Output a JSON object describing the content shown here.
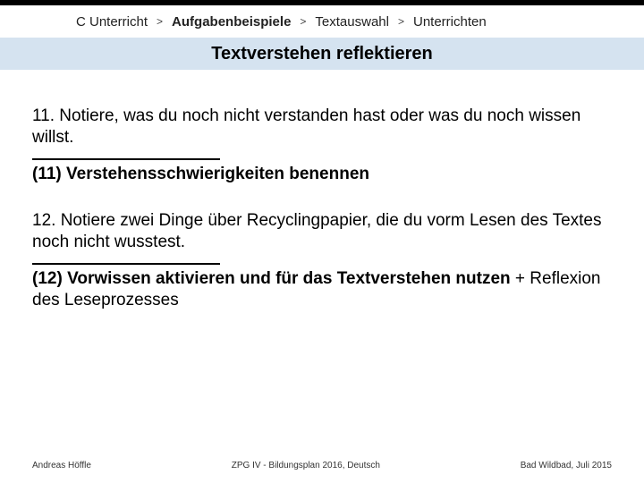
{
  "breadcrumb": {
    "items": [
      {
        "label": "C Unterricht",
        "bold": false
      },
      {
        "label": "Aufgabenbeispiele",
        "bold": true
      },
      {
        "label": "Textauswahl",
        "bold": false
      },
      {
        "label": "Unterrichten",
        "bold": false
      }
    ],
    "separator": ">"
  },
  "title": "Textverstehen reflektieren",
  "tasks": [
    {
      "prompt": "11. Notiere, was du noch nicht verstanden hast oder was du noch wissen willst.",
      "label_prefix": "(11) ",
      "label_main": "Verstehensschwierigkeiten benennen",
      "label_suffix": ""
    },
    {
      "prompt": "12. Notiere zwei Dinge über Recyclingpapier, die du vorm Lesen des Textes noch nicht wusstest.",
      "label_prefix": "(12) ",
      "label_main": "Vorwissen aktivieren und für das Textverstehen nutzen",
      "label_suffix": " + Reflexion des Leseprozesses"
    }
  ],
  "footer": {
    "left": "Andreas Höffle",
    "center": "ZPG IV - Bildungsplan 2016, Deutsch",
    "right": "Bad Wildbad, Juli 2015"
  }
}
